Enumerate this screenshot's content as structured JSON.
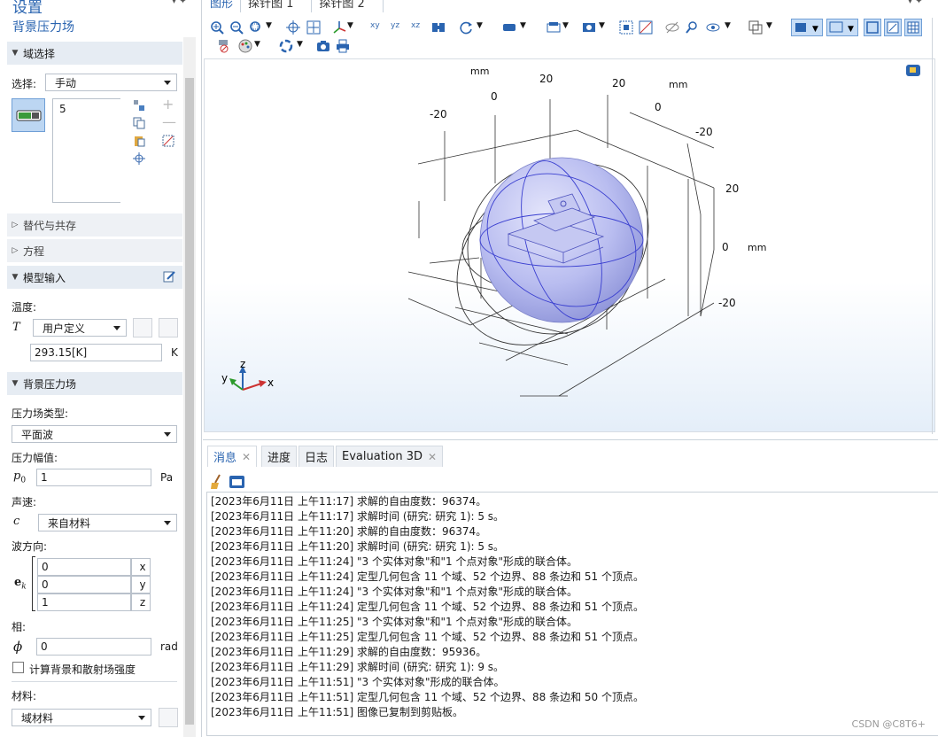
{
  "settings": {
    "header_title": "设置",
    "node_name": "背景压力场",
    "domain_section": {
      "title": "域选择",
      "select_label": "选择:",
      "select_value": "手动",
      "list_values": [
        "5"
      ]
    },
    "collapsed_sections": [
      "替代与共存",
      "方程"
    ],
    "model_input": {
      "title": "模型输入",
      "temperature_label": "温度:",
      "temperature_symbol": "T",
      "temperature_mode": "用户定义",
      "temperature_value": "293.15[K]",
      "temperature_unit": "K"
    },
    "pressure_section": {
      "title": "背景压力场",
      "field_type_label": "压力场类型:",
      "field_type_value": "平面波",
      "amplitude_label": "压力幅值:",
      "amplitude_symbol": "p",
      "amplitude_sub": "0",
      "amplitude_value": "1",
      "amplitude_unit": "Pa",
      "speed_label": "声速:",
      "speed_symbol": "c",
      "speed_value": "来自材料",
      "wave_dir_label": "波方向:",
      "wave_dir_symbol": "e",
      "wave_dir_sub": "k",
      "wave_dir": [
        {
          "value": "0",
          "comp": "x"
        },
        {
          "value": "0",
          "comp": "y"
        },
        {
          "value": "1",
          "comp": "z"
        }
      ],
      "phase_label": "相:",
      "phase_symbol": "ϕ",
      "phase_value": "0",
      "phase_unit": "rad",
      "checkbox_label": "计算背景和散射场强度",
      "material_label": "材料:",
      "material_value": "域材料"
    }
  },
  "graphics": {
    "tabs": [
      "图形",
      "探针图 1",
      "探针图 2"
    ],
    "axis_labels": {
      "top_unit1": "mm",
      "top_unit2": "mm",
      "right_unit": "mm",
      "t1": "-20",
      "t2": "0",
      "t3": "20",
      "t4": "20",
      "t5": "0",
      "t6": "-20",
      "r1": "20",
      "r2": "0",
      "r3": "-20"
    },
    "triad": {
      "x": "x",
      "y": "y",
      "z": "z"
    }
  },
  "messages": {
    "tabs": [
      "消息",
      "进度",
      "日志",
      "Evaluation 3D"
    ],
    "lines": [
      "[2023年6月11日 上午11:17] 求解的自由度数：96374。",
      "[2023年6月11日 上午11:17] 求解时间 (研究: 研究 1): 5 s。",
      "[2023年6月11日 上午11:20] 求解的自由度数：96374。",
      "[2023年6月11日 上午11:20] 求解时间 (研究: 研究 1): 5 s。",
      "[2023年6月11日 上午11:24] \"3 个实体对象\"和\"1 个点对象\"形成的联合体。",
      "[2023年6月11日 上午11:24] 定型几何包含 11 个域、52 个边界、88 条边和 51 个顶点。",
      "[2023年6月11日 上午11:24] \"3 个实体对象\"和\"1 个点对象\"形成的联合体。",
      "[2023年6月11日 上午11:24] 定型几何包含 11 个域、52 个边界、88 条边和 51 个顶点。",
      "[2023年6月11日 上午11:25] \"3 个实体对象\"和\"1 个点对象\"形成的联合体。",
      "[2023年6月11日 上午11:25] 定型几何包含 11 个域、52 个边界、88 条边和 51 个顶点。",
      "[2023年6月11日 上午11:29] 求解的自由度数：95936。",
      "[2023年6月11日 上午11:29] 求解时间 (研究: 研究 1): 9 s。",
      "[2023年6月11日 上午11:51] \"3 个实体对象\"形成的联合体。",
      "[2023年6月11日 上午11:51] 定型几何包含 11 个域、52 个边界、88 条边和 50 个顶点。",
      "[2023年6月11日 上午11:51] 图像已复制到剪贴板。"
    ],
    "watermark": "CSDN @C8T6+"
  },
  "colors": {
    "accent": "#2a64b0",
    "section_bg": "#e6ecf3",
    "sphere": "#b9bdf0"
  }
}
